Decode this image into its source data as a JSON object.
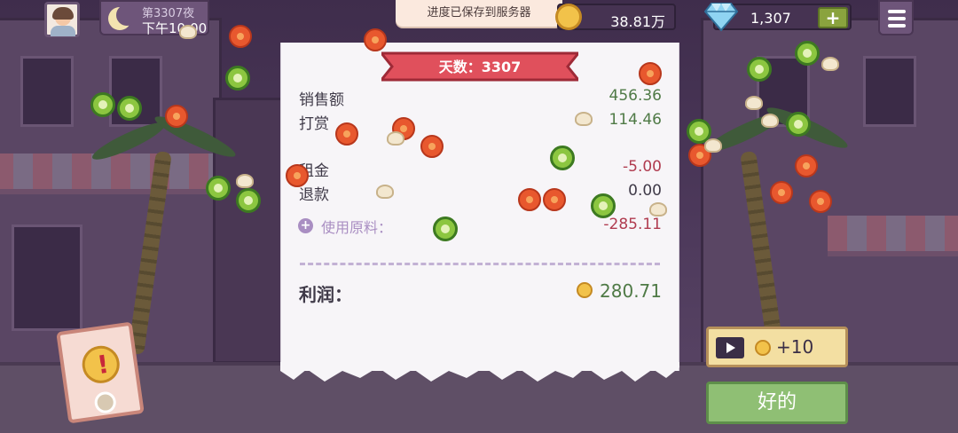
{
  "hud": {
    "day_night": "第3307夜",
    "time": "下午10:00",
    "saved_message": "进度已保存到服务器",
    "coins": "38.81万",
    "gems": "1,307",
    "gem_plus": "+"
  },
  "receipt": {
    "title": "天数：3307",
    "rows": [
      {
        "label": "销售额",
        "value": "456.36"
      },
      {
        "label": "打赏",
        "value": "114.46"
      },
      {
        "label": "租金",
        "value": "-5.00"
      },
      {
        "label": "退款",
        "value": "0.00"
      }
    ],
    "ingredients_label": "使用原料：",
    "ingredients_value": "-285.11",
    "profit_label": "利润：",
    "profit_value": "280.71"
  },
  "buttons": {
    "ad_reward": "+10",
    "ok": "好的"
  },
  "alert": {
    "symbol": "!"
  },
  "colors": {
    "positive": "#4f7a46",
    "negative": "#b03b4f",
    "ribbon": "#e0505c",
    "ok_button": "#8fbf74"
  }
}
